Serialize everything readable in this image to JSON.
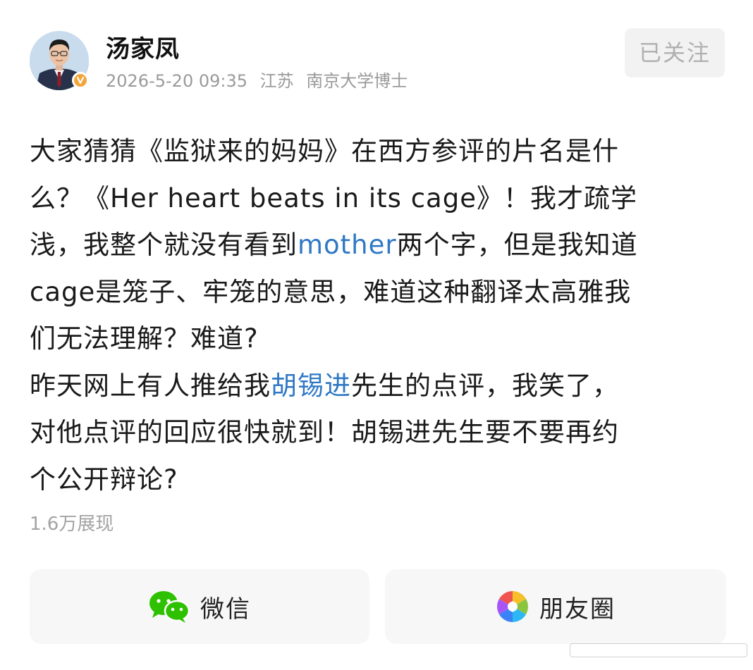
{
  "user": {
    "name": "汤家凤",
    "timestamp": "2026-5-20 09:35",
    "location": "江苏",
    "title": "南京大学博士",
    "verified_badge": "V"
  },
  "actions": {
    "follow_label": "已关注"
  },
  "post": {
    "lines": [
      [
        {
          "t": "大家猜猜《监狱来的妈妈》在西方参评的片名是什"
        }
      ],
      [
        {
          "t": "么？《Her heart beats in its cage》！我才疏学"
        }
      ],
      [
        {
          "t": "浅，我整个就没有看到"
        },
        {
          "t": "mother",
          "link": true
        },
        {
          "t": "两个字，但是我知道"
        }
      ],
      [
        {
          "t": "cage是笼子、牢笼的意思，难道这种翻译太高雅我"
        }
      ],
      [
        {
          "t": "们无法理解？难道?"
        }
      ],
      [
        {
          "t": "昨天网上有人推给我"
        },
        {
          "t": "胡锡进",
          "link": true
        },
        {
          "t": "先生的点评，我笑了，"
        }
      ],
      [
        {
          "t": "对他点评的回应很快就到！胡锡进先生要不要再约"
        }
      ],
      [
        {
          "t": "个公开辩论?"
        }
      ]
    ],
    "view_count": "1.6万展现"
  },
  "share": {
    "wechat_label": "微信",
    "moments_label": "朋友圈"
  },
  "colors": {
    "link": "#2f78c4",
    "meta": "#9a9a9a",
    "wechat_green": "#2dc100",
    "badge": "#f3a43a"
  },
  "icons": {
    "wechat": "wechat-icon",
    "moments": "moments-aperture-icon",
    "verified": "verified-badge-icon"
  }
}
